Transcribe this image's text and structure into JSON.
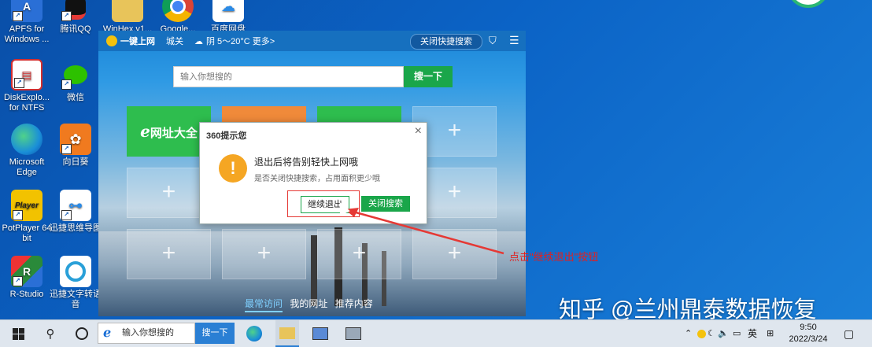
{
  "desktop": {
    "icons": [
      {
        "label": "APFS for Windows ...",
        "short": "A",
        "color": "#2a6fd6",
        "icon": "apfs-icon"
      },
      {
        "label": "腾讯QQ",
        "short": "Q",
        "color": "#111111",
        "icon": "qq-penguin-icon"
      },
      {
        "label": "WinHex.v1...",
        "short": "",
        "color": "#e8c45a",
        "icon": "folder-icon"
      },
      {
        "label": "Google...",
        "short": "",
        "color": "#ffffff",
        "icon": "chrome-icon"
      },
      {
        "label": "百度网盘",
        "short": "",
        "color": "#ffffff",
        "icon": "baidu-netdisk-icon"
      },
      {
        "label": "DiskExplo... for NTFS",
        "short": "",
        "color": "#d32f2f",
        "icon": "disk-explorer-icon"
      },
      {
        "label": "微信",
        "short": "",
        "color": "#2dc100",
        "icon": "wechat-icon"
      },
      {
        "label": "Microsoft Edge",
        "short": "",
        "color": "#1a8fd8",
        "icon": "edge-icon"
      },
      {
        "label": "向日葵",
        "short": "",
        "color": "#f07a1f",
        "icon": "sunflower-icon"
      },
      {
        "label": "PotPlayer 64 bit",
        "short": "Player",
        "color": "#f2c200",
        "icon": "potplayer-icon"
      },
      {
        "label": "迅捷思维导图",
        "short": "",
        "color": "#ffffff",
        "icon": "mindmap-icon"
      },
      {
        "label": "R-Studio",
        "short": "",
        "color": "#2a8a3a",
        "icon": "r-studio-icon"
      },
      {
        "label": "迅捷文字转语音",
        "short": "",
        "color": "#ffffff",
        "icon": "text-to-speech-icon"
      }
    ]
  },
  "browser": {
    "brand": "一键上网",
    "city": "城关",
    "weather": "阴 5～20°C 更多>",
    "close_quick_search": "关闭快捷搜索",
    "search_placeholder": "输入你想搜的",
    "search_button": "搜一下",
    "tile_featured": "网址大全",
    "tile_plus": "+",
    "tabs": [
      "最常访问",
      "我的网址",
      "推荐内容"
    ]
  },
  "dialog": {
    "title": "360提示您",
    "close": "×",
    "warning_glyph": "!",
    "message": "退出后将告别轻快上网哦",
    "sub_message": "是否关闭快捷搜索，占用面积更少哦",
    "continue_exit": "继续退出",
    "close_search": "关闭搜索"
  },
  "annotation": {
    "text": "点击\"继续退出\"按钮",
    "color": "#e02020"
  },
  "watermark": "知乎 @兰州鼎泰数据恢复",
  "taskbar": {
    "search_placeholder": "输入你想搜的",
    "search_button": "搜一下",
    "tray_text": "英",
    "time": "9:50",
    "date": "2022/3/24"
  }
}
